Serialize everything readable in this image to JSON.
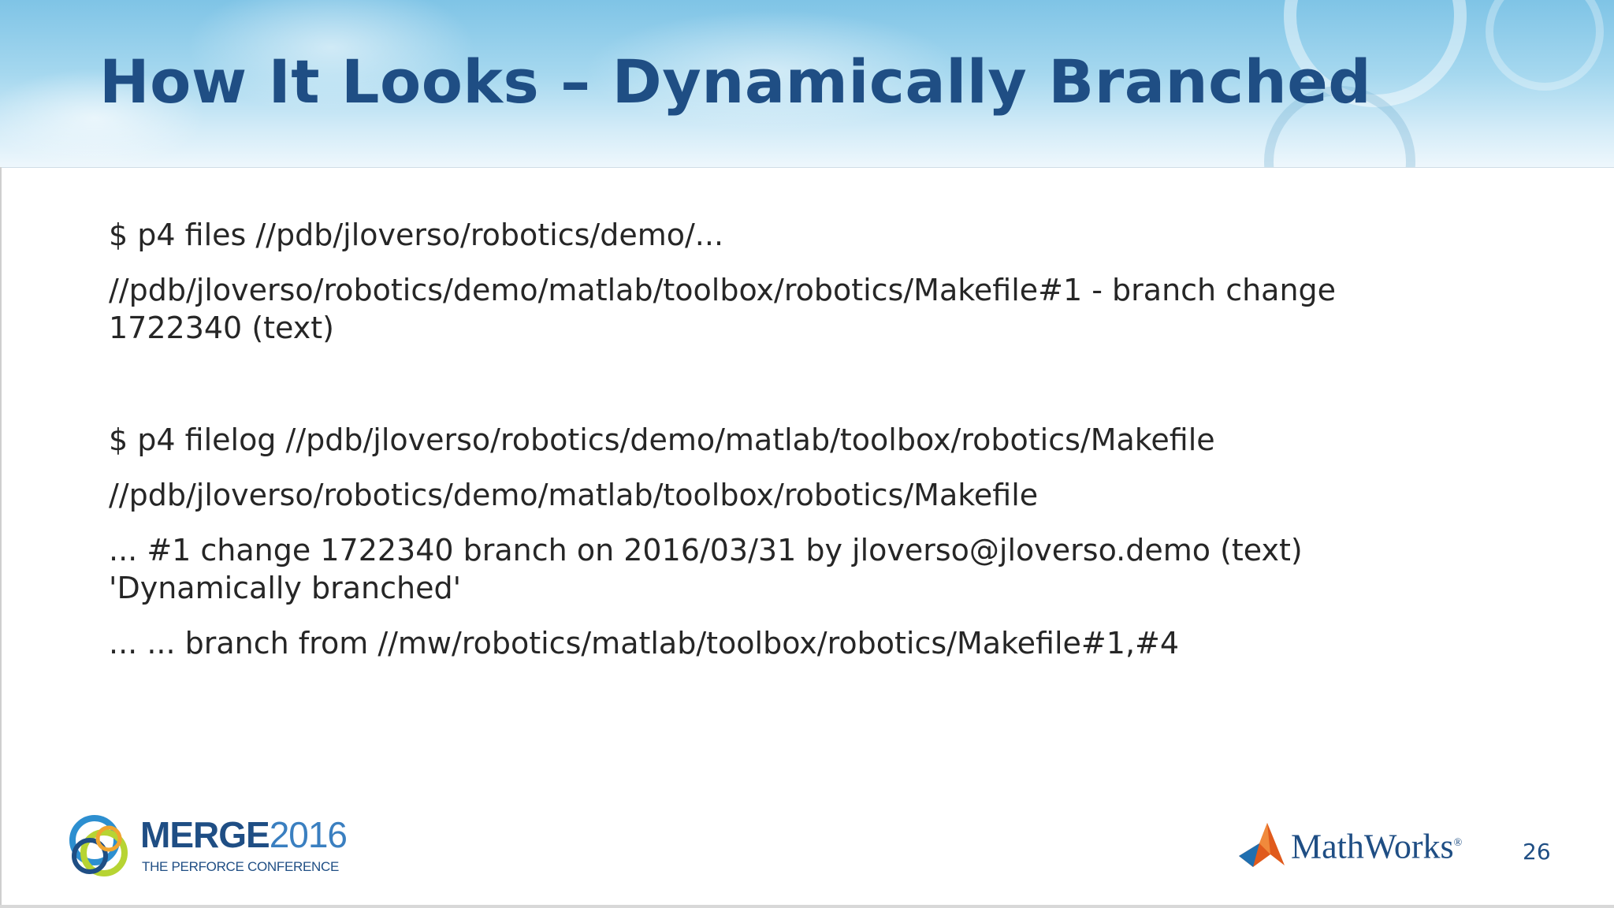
{
  "slide": {
    "title": "How It Looks – Dynamically Branched",
    "lines": [
      "$ p4 files //pdb/jloverso/robotics/demo/...",
      "//pdb/jloverso/robotics/demo/matlab/toolbox/robotics/Makefile#1 - branch change",
      "1722340 (text)",
      "$ p4 filelog //pdb/jloverso/robotics/demo/matlab/toolbox/robotics/Makefile",
      "//pdb/jloverso/robotics/demo/matlab/toolbox/robotics/Makefile",
      "... #1 change 1722340 branch on 2016/03/31 by jloverso@jloverso.demo (text)",
      "'Dynamically branched'",
      "... ... branch from //mw/robotics/matlab/toolbox/robotics/Makefile#1,#4"
    ],
    "page_number": "26"
  },
  "footer": {
    "merge_logo": {
      "word": "MERGE",
      "year": "2016",
      "tagline": "THE PERFORCE CONFERENCE"
    },
    "mathworks_logo": {
      "text": "MathWorks",
      "mark": "®"
    }
  },
  "colors": {
    "title": "#1f4e84",
    "body_text": "#262626",
    "header_sky": "#a6d8ef",
    "merge_green": "#b7d433",
    "merge_blue": "#2d8fd0",
    "mathworks_orange": "#e05a1c"
  }
}
